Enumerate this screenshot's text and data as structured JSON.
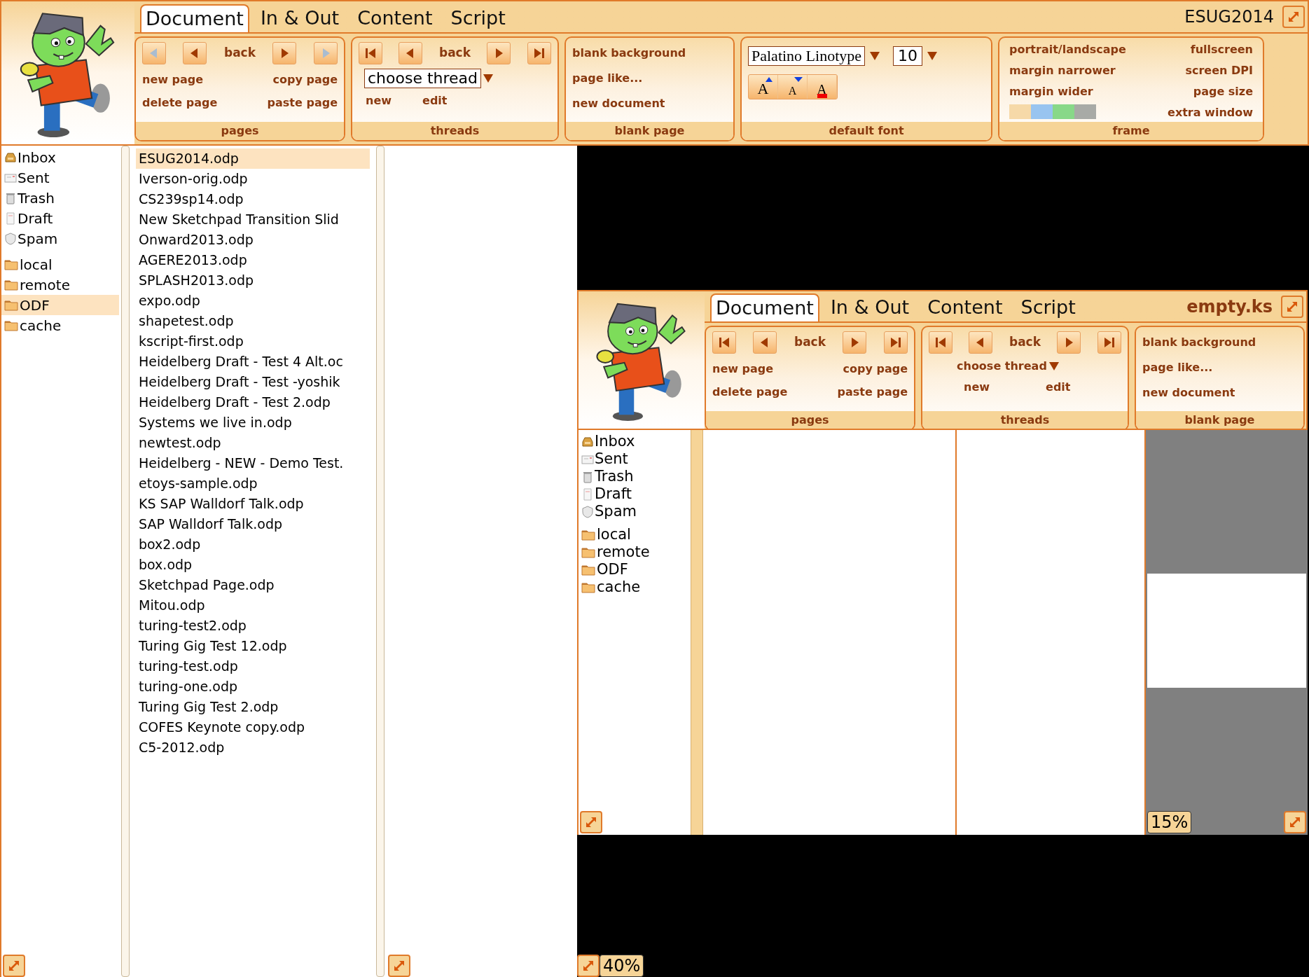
{
  "main_window": {
    "tabs": [
      {
        "label": "Document",
        "selected": true
      },
      {
        "label": "In & Out",
        "selected": false
      },
      {
        "label": "Content",
        "selected": false
      },
      {
        "label": "Script",
        "selected": false
      }
    ],
    "title": {
      "text": "ESUG2014",
      "emphasized": false
    },
    "groups": [
      {
        "kind": "pages",
        "caption": "pages",
        "nav": [
          {
            "kind": "prev",
            "disabled": true
          },
          {
            "kind": "prev",
            "disabled": false
          },
          {
            "kind": "text",
            "text": "back"
          },
          {
            "kind": "next",
            "disabled": false
          },
          {
            "kind": "next",
            "disabled": true
          }
        ],
        "actions": [
          "new page",
          "copy page",
          "delete page",
          "paste page"
        ]
      },
      {
        "kind": "threads",
        "caption": "threads",
        "nav": [
          {
            "kind": "first",
            "disabled": false
          },
          {
            "kind": "prev",
            "disabled": false
          },
          {
            "kind": "text",
            "text": "back"
          },
          {
            "kind": "next",
            "disabled": false
          },
          {
            "kind": "last",
            "disabled": false
          }
        ],
        "selector": {
          "kind": "field",
          "text": "choose thread"
        },
        "actions": [
          "new",
          "edit"
        ]
      },
      {
        "kind": "blank",
        "caption": "blank page",
        "actions": [
          "blank background",
          "page like...",
          "new document"
        ]
      },
      {
        "kind": "font",
        "caption": "default font",
        "font_name": "Palatino Linotype",
        "font_size": "10",
        "style_buttons": [
          {
            "kind": "grow",
            "text": "A"
          },
          {
            "kind": "shrink",
            "text": "A"
          },
          {
            "kind": "color",
            "text": "A"
          }
        ]
      },
      {
        "kind": "frame",
        "caption": "frame",
        "actions_left": [
          "portrait/landscape",
          "margin narrower",
          "margin wider"
        ],
        "actions_right": [
          "fullscreen",
          "screen DPI",
          "page size",
          "extra window"
        ],
        "swatches": [
          {
            "color": "#f6d9a8"
          },
          {
            "color": "#98c4f0"
          },
          {
            "color": "#88d888"
          },
          {
            "color": "#a8aaa6"
          }
        ]
      }
    ],
    "mailboxes": [
      {
        "kind": "inbox",
        "label": "Inbox",
        "selected": false
      },
      {
        "kind": "sent",
        "label": "Sent",
        "selected": false
      },
      {
        "kind": "trash",
        "label": "Trash",
        "selected": false
      },
      {
        "kind": "draft",
        "label": "Draft",
        "selected": false
      },
      {
        "kind": "spam",
        "label": "Spam",
        "selected": false
      }
    ],
    "folders": [
      {
        "label": "local",
        "selected": false
      },
      {
        "label": "remote",
        "selected": false
      },
      {
        "label": "ODF",
        "selected": true
      },
      {
        "label": "cache",
        "selected": false
      }
    ],
    "files": [
      {
        "name": "ESUG2014.odp",
        "selected": true
      },
      {
        "name": "Iverson-orig.odp",
        "selected": false
      },
      {
        "name": "CS239sp14.odp",
        "selected": false
      },
      {
        "name": "New Sketchpad Transition Slid",
        "selected": false
      },
      {
        "name": "Onward2013.odp",
        "selected": false
      },
      {
        "name": "AGERE2013.odp",
        "selected": false
      },
      {
        "name": "SPLASH2013.odp",
        "selected": false
      },
      {
        "name": "expo.odp",
        "selected": false
      },
      {
        "name": "shapetest.odp",
        "selected": false
      },
      {
        "name": "kscript-first.odp",
        "selected": false
      },
      {
        "name": "Heidelberg Draft - Test 4 Alt.oc",
        "selected": false
      },
      {
        "name": "Heidelberg Draft - Test -yoshik",
        "selected": false
      },
      {
        "name": "Heidelberg Draft - Test 2.odp",
        "selected": false
      },
      {
        "name": "Systems we live in.odp",
        "selected": false
      },
      {
        "name": "newtest.odp",
        "selected": false
      },
      {
        "name": "Heidelberg - NEW - Demo Test.",
        "selected": false
      },
      {
        "name": "etoys-sample.odp",
        "selected": false
      },
      {
        "name": "KS SAP Walldorf Talk.odp",
        "selected": false
      },
      {
        "name": "SAP Walldorf Talk.odp",
        "selected": false
      },
      {
        "name": "box2.odp",
        "selected": false
      },
      {
        "name": "box.odp",
        "selected": false
      },
      {
        "name": "Sketchpad Page.odp",
        "selected": false
      },
      {
        "name": "Mitou.odp",
        "selected": false
      },
      {
        "name": "turing-test2.odp",
        "selected": false
      },
      {
        "name": "Turing Gig Test 12.odp",
        "selected": false
      },
      {
        "name": "turing-test.odp",
        "selected": false
      },
      {
        "name": "turing-one.odp",
        "selected": false
      },
      {
        "name": "Turing Gig Test 2.odp",
        "selected": false
      },
      {
        "name": "COFES Keynote copy.odp",
        "selected": false
      },
      {
        "name": "C5-2012.odp",
        "selected": false
      }
    ],
    "zoom": "40%"
  },
  "inner_window": {
    "tabs": [
      {
        "label": "Document",
        "selected": true
      },
      {
        "label": "In & Out",
        "selected": false
      },
      {
        "label": "Content",
        "selected": false
      },
      {
        "label": "Script",
        "selected": false
      }
    ],
    "title": {
      "text": "empty.ks",
      "emphasized": true
    },
    "groups": [
      {
        "kind": "pages",
        "caption": "pages",
        "nav": [
          {
            "kind": "first",
            "disabled": false
          },
          {
            "kind": "prev",
            "disabled": false
          },
          {
            "kind": "text",
            "text": "back"
          },
          {
            "kind": "next",
            "disabled": false
          },
          {
            "kind": "last",
            "disabled": false
          }
        ],
        "actions": [
          "new page",
          "copy page",
          "delete page",
          "paste page"
        ]
      },
      {
        "kind": "threads",
        "caption": "threads",
        "nav": [
          {
            "kind": "first",
            "disabled": false
          },
          {
            "kind": "prev",
            "disabled": false
          },
          {
            "kind": "text",
            "text": "back"
          },
          {
            "kind": "next",
            "disabled": false
          },
          {
            "kind": "last",
            "disabled": false
          }
        ],
        "selector": {
          "kind": "label",
          "text": "choose thread"
        },
        "actions": [
          "new",
          "edit"
        ]
      },
      {
        "kind": "blank",
        "caption": "blank page",
        "actions": [
          "blank background",
          "page like...",
          "new document"
        ]
      }
    ],
    "mailboxes": [
      {
        "kind": "inbox",
        "label": "Inbox",
        "selected": false
      },
      {
        "kind": "sent",
        "label": "Sent",
        "selected": false
      },
      {
        "kind": "trash",
        "label": "Trash",
        "selected": false
      },
      {
        "kind": "draft",
        "label": "Draft",
        "selected": false
      },
      {
        "kind": "spam",
        "label": "Spam",
        "selected": false
      }
    ],
    "folders": [
      {
        "label": "local",
        "selected": false
      },
      {
        "label": "remote",
        "selected": false
      },
      {
        "label": "ODF",
        "selected": false
      },
      {
        "label": "cache",
        "selected": false
      }
    ],
    "zoom": "15%"
  }
}
